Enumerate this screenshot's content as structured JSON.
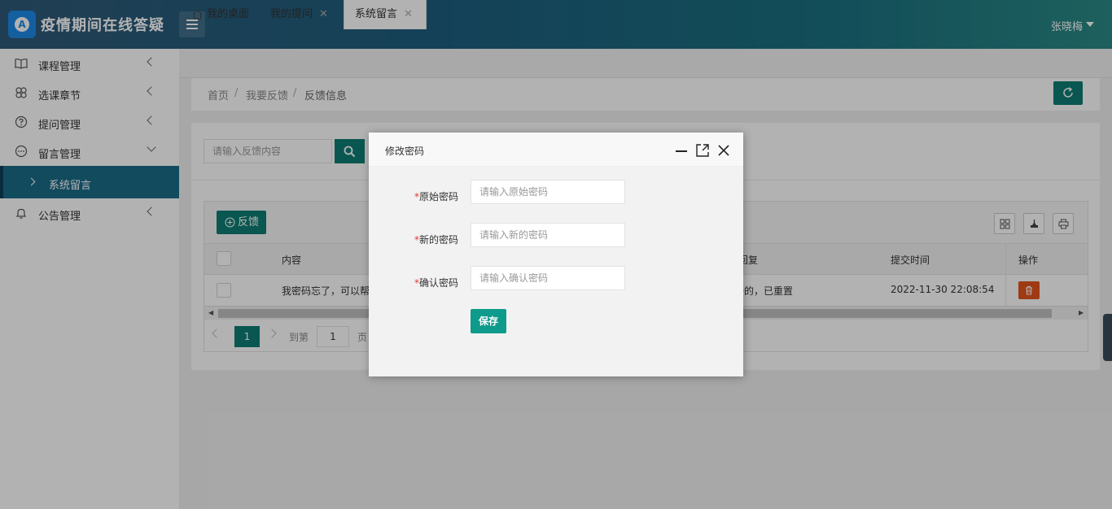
{
  "header": {
    "app_title": "疫情期间在线答疑",
    "logo_letter": "A",
    "user_name": "张晓梅"
  },
  "sidebar": {
    "items": [
      {
        "label": "课程管理",
        "icon": "book-icon"
      },
      {
        "label": "选课章节",
        "icon": "clover-icon"
      },
      {
        "label": "提问管理",
        "icon": "question-circle-icon"
      },
      {
        "label": "留言管理",
        "icon": "message-circle-icon"
      },
      {
        "label": "公告管理",
        "icon": "bell-icon"
      }
    ],
    "sub_item": {
      "label": "系统留言"
    }
  },
  "tabs": [
    {
      "label": "我的桌面"
    },
    {
      "label": "我的提问",
      "close": "✕"
    },
    {
      "label": "系统留言",
      "close": "✕"
    }
  ],
  "breadcrumb": {
    "home": "首页",
    "sep": "/",
    "level1": "我要反馈",
    "current": "反馈信息"
  },
  "search": {
    "placeholder": "请输入反馈内容"
  },
  "toolbar": {
    "add_label": "反馈"
  },
  "table": {
    "headers": {
      "content": "内容",
      "reply": "回复",
      "time": "提交时间",
      "ops": "操作"
    },
    "rows": [
      {
        "content": "我密码忘了，可以帮",
        "reply": "好的，已重置",
        "time": "2022-11-30 22:08:54"
      }
    ]
  },
  "pagination": {
    "current": "1",
    "goto_label": "到第",
    "goto_value": "1",
    "page_label": "页"
  },
  "modal": {
    "title": "修改密码",
    "required_mark": "*",
    "fields": [
      {
        "label": "原始密码",
        "placeholder": "请输入原始密码"
      },
      {
        "label": "新的密码",
        "placeholder": "请输入新的密码"
      },
      {
        "label": "确认密码",
        "placeholder": "请输入确认密码"
      }
    ],
    "save_label": "保存"
  },
  "colors": {
    "primary": "#0e7d73",
    "sidebar_active": "#1b6b87",
    "danger": "#e2541e",
    "required": "#e53935"
  }
}
